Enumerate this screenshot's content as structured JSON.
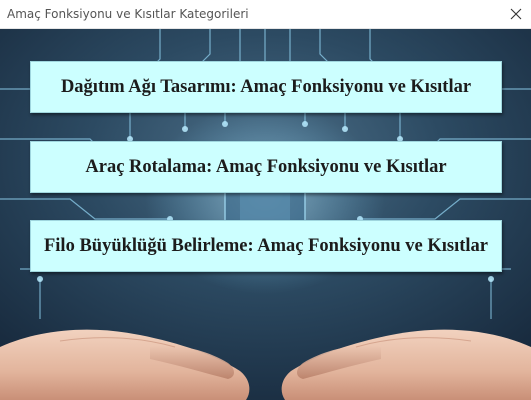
{
  "window": {
    "title": "Amaç Fonksiyonu ve Kısıtlar Kategorileri",
    "close_icon": "close-icon"
  },
  "menu": {
    "buttons": [
      {
        "label": "Dağıtım Ağı Tasarımı: Amaç Fonksiyonu ve Kısıtlar"
      },
      {
        "label": "Araç Rotalama: Amaç Fonksiyonu ve Kısıtlar"
      },
      {
        "label": "Filo Büyüklüğü Belirleme: Amaç Fonksiyonu ve Kısıtlar"
      }
    ]
  },
  "colors": {
    "button_fill": "#ccffff",
    "background_dark": "#1d3247",
    "circuit_glow": "#7fd6ff"
  }
}
